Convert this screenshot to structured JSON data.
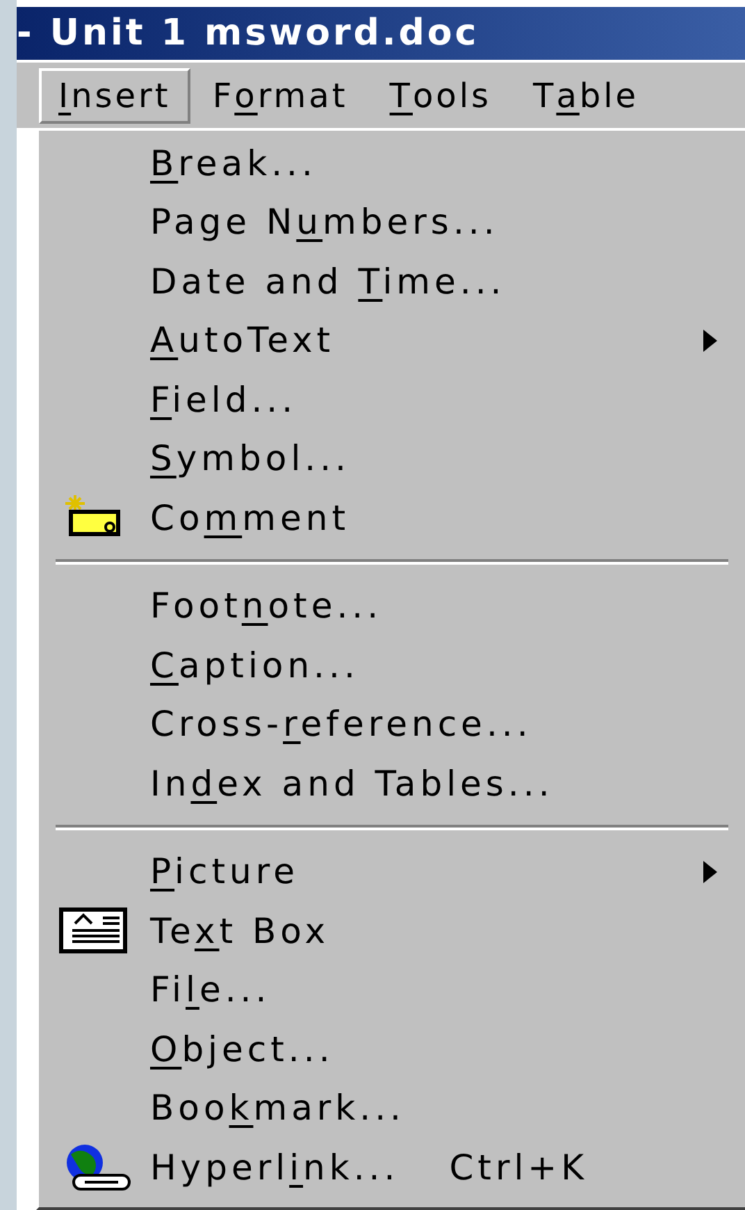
{
  "window": {
    "title": "- Unit 1 msword.doc"
  },
  "menubar": [
    {
      "key": "I",
      "post": "nsert",
      "selected": true
    },
    {
      "pre": "F",
      "key": "o",
      "post": "rmat",
      "selected": false
    },
    {
      "key": "T",
      "post": "ools",
      "selected": false
    },
    {
      "pre": "T",
      "key": "a",
      "post": "ble",
      "selected": false
    }
  ],
  "menu": [
    {
      "kind": "item",
      "key": "B",
      "post": "reak...",
      "submenu": false
    },
    {
      "kind": "item",
      "pre": "Page N",
      "key": "u",
      "post": "mbers...",
      "submenu": false
    },
    {
      "kind": "item",
      "pre": "Date and ",
      "key": "T",
      "post": "ime...",
      "submenu": false
    },
    {
      "kind": "item",
      "key": "A",
      "post": "utoText",
      "submenu": true
    },
    {
      "kind": "item",
      "key": "F",
      "post": "ield...",
      "submenu": false
    },
    {
      "kind": "item",
      "key": "S",
      "post": "ymbol...",
      "submenu": false
    },
    {
      "kind": "item",
      "pre": "Co",
      "key": "m",
      "post": "ment",
      "submenu": false
    },
    {
      "kind": "separator"
    },
    {
      "kind": "item",
      "pre": "Foot",
      "key": "n",
      "post": "ote...",
      "submenu": false
    },
    {
      "kind": "item",
      "key": "C",
      "post": "aption...",
      "submenu": false
    },
    {
      "kind": "item",
      "pre": "Cross-",
      "key": "r",
      "post": "eference...",
      "submenu": false
    },
    {
      "kind": "item",
      "pre": "In",
      "key": "d",
      "post": "ex and Tables...",
      "submenu": false
    },
    {
      "kind": "separator"
    },
    {
      "kind": "item",
      "key": "P",
      "post": "icture",
      "submenu": true
    },
    {
      "kind": "item",
      "pre": "Te",
      "key": "x",
      "post": "t Box",
      "submenu": false
    },
    {
      "kind": "item",
      "pre": "Fi",
      "key": "l",
      "post": "e...",
      "submenu": false
    },
    {
      "kind": "item",
      "key": "O",
      "post": "bject...",
      "submenu": false
    },
    {
      "kind": "item",
      "pre": "Boo",
      "key": "k",
      "post": "mark...",
      "submenu": false
    },
    {
      "kind": "item",
      "pre": "Hyperl",
      "key": "i",
      "post": "nk...",
      "submenu": false,
      "shortcut": "Ctrl+K"
    }
  ]
}
